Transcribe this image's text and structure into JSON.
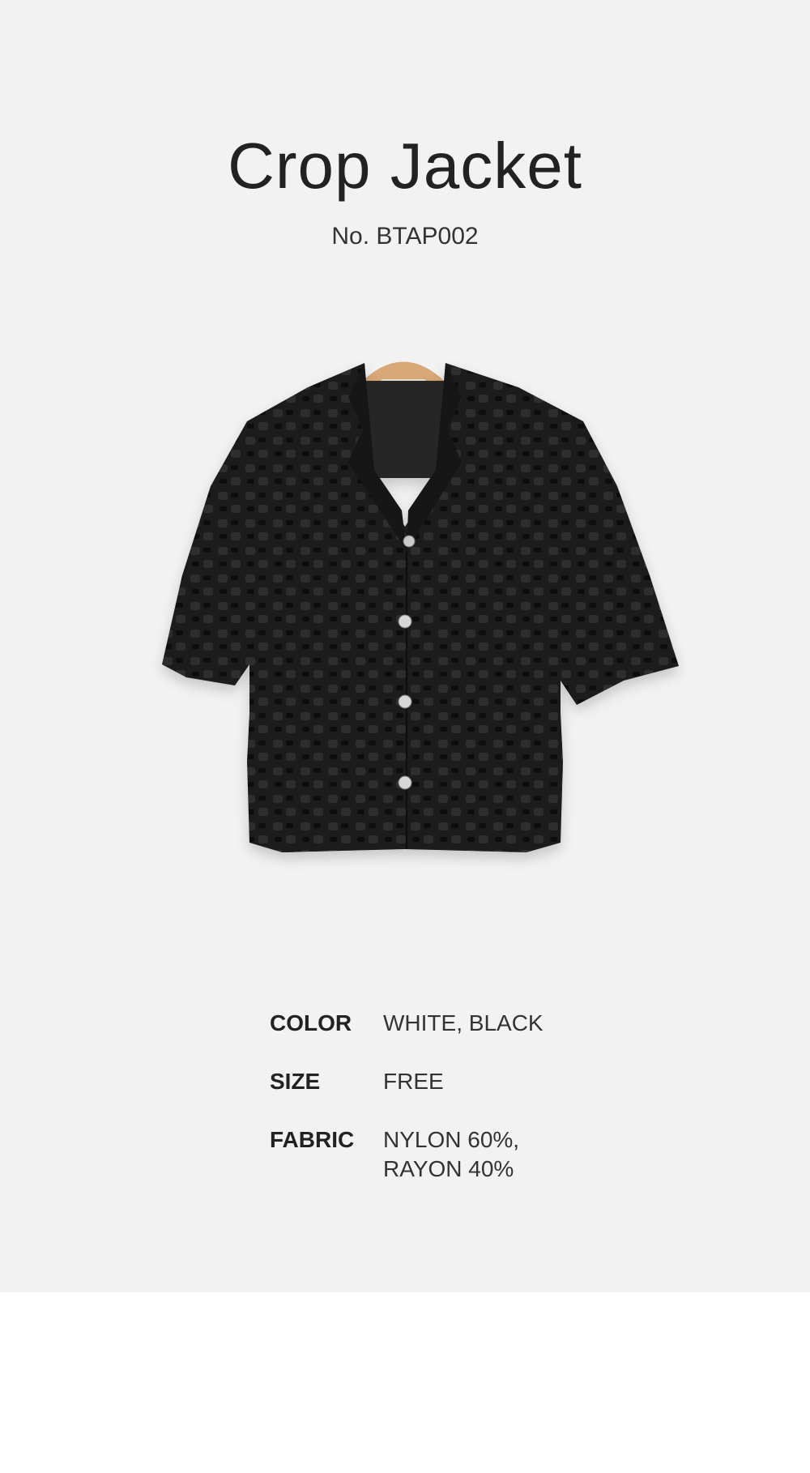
{
  "product": {
    "title": "Crop Jacket",
    "code": "No. BTAP002",
    "image_label": "black fringe short-sleeve crop jacket on wooden hanger"
  },
  "specs": [
    {
      "label": "COLOR",
      "value_lines": [
        "WHITE, BLACK"
      ]
    },
    {
      "label": "SIZE",
      "value_lines": [
        "FREE"
      ]
    },
    {
      "label": "FABRIC",
      "value_lines": [
        "NYLON 60%,",
        "RAYON 40%"
      ]
    }
  ],
  "colors": {
    "panel_background": "#f2f2f2",
    "page_background": "#ffffff",
    "text_primary": "#222222",
    "jacket": "#1b1b1b",
    "hanger": "#d9a877"
  }
}
